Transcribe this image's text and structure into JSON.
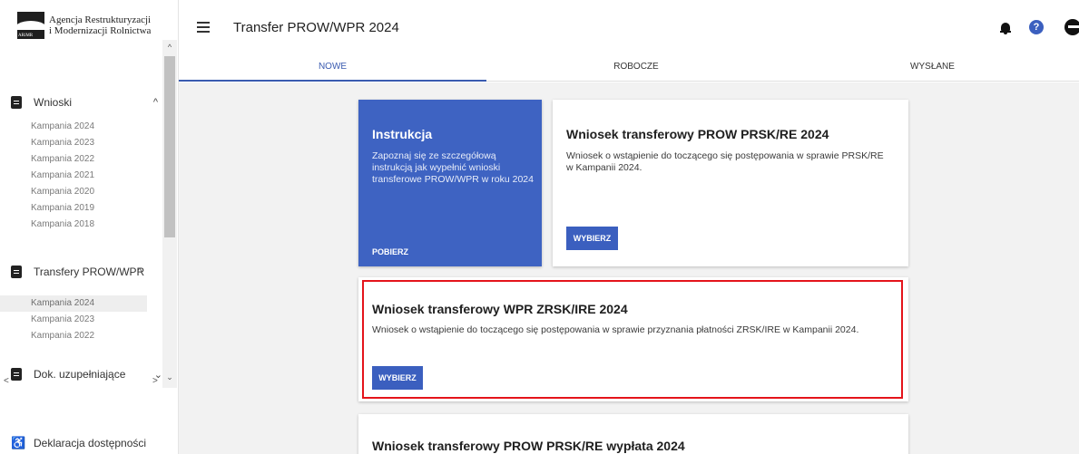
{
  "logo": {
    "line1": "Agencja Restrukturyzacji",
    "line2": "i Modernizacji Rolnictwa",
    "abbr": "ARiMR"
  },
  "header": {
    "title": "Transfer PROW/WPR 2024"
  },
  "tabs": [
    {
      "label": "NOWE",
      "active": true
    },
    {
      "label": "ROBOCZE",
      "active": false
    },
    {
      "label": "WYSŁANE",
      "active": false
    }
  ],
  "sidebar": {
    "groups": [
      {
        "label": "Wnioski",
        "chevron": "^",
        "items": [
          "Kampania 2024",
          "Kampania 2023",
          "Kampania 2022",
          "Kampania 2021",
          "Kampania 2020",
          "Kampania 2019",
          "Kampania 2018"
        ]
      },
      {
        "label": "Transfery PROW/WPR",
        "chevron": "^",
        "items": [
          "Kampania 2024",
          "Kampania 2023",
          "Kampania 2022"
        ]
      },
      {
        "label": "Dok. uzupełniające",
        "chevron": "⌄"
      }
    ],
    "accessibility": "Deklaracja dostępności"
  },
  "instruction_card": {
    "title": "Instrukcja",
    "text": "Zapoznaj się ze szczegółową instrukcją jak wypełnić wnioski transferowe PROW/WPR w roku 2024",
    "link": "POBIERZ"
  },
  "cards": [
    {
      "title": "Wniosek transferowy PROW PRSK/RE 2024",
      "text": "Wniosek o wstąpienie do toczącego się postępowania w sprawie PRSK/RE w Kampanii 2024.",
      "button": "WYBIERZ"
    },
    {
      "title": "Wniosek transferowy WPR ZRSK/IRE 2024",
      "text": "Wniosek o wstąpienie do toczącego się postępowania w sprawie przyznania płatności ZRSK/IRE w Kampanii 2024.",
      "button": "WYBIERZ"
    },
    {
      "title": "Wniosek transferowy PROW PRSK/RE wypłata 2024"
    }
  ],
  "colors": {
    "accent": "#3b5fbf",
    "highlight": "#e4141b",
    "background": "#f2f2f2"
  }
}
